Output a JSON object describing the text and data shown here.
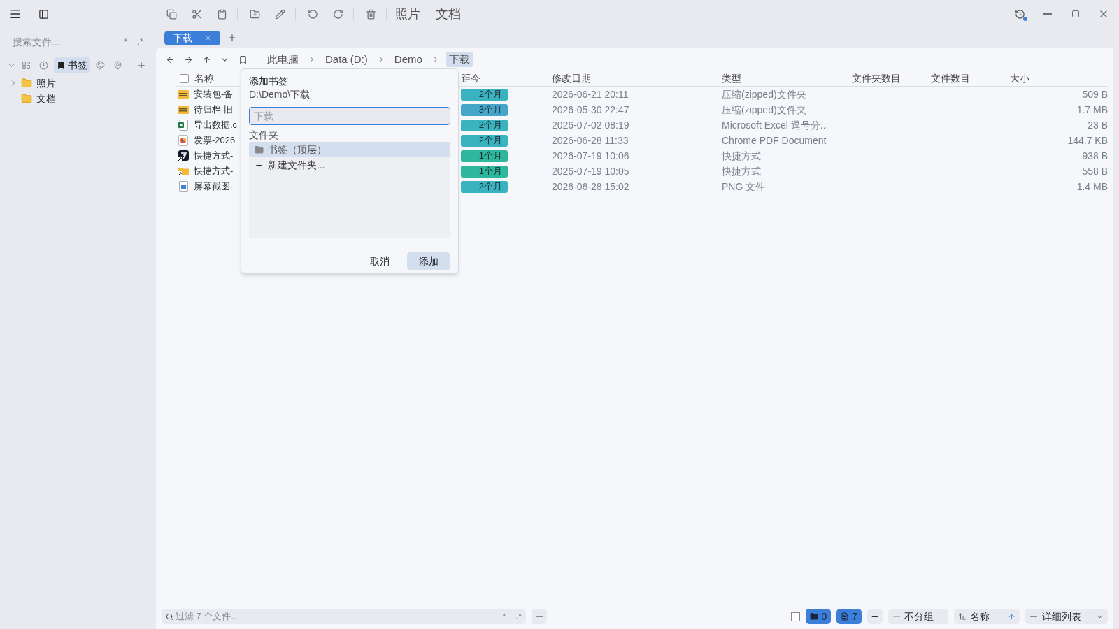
{
  "toolbar": {
    "quick_links": [
      {
        "label": "照片"
      },
      {
        "label": "文档"
      }
    ]
  },
  "sidebar": {
    "search": {
      "placeholder": "搜索文件...",
      "options": [
        "*",
        ".*"
      ]
    },
    "panel_tabs": [
      {
        "kind": "layout",
        "selected": false
      },
      {
        "kind": "recent",
        "selected": false
      },
      {
        "kind": "bookmarks",
        "label": "书签",
        "selected": true
      },
      {
        "kind": "tags",
        "selected": false
      },
      {
        "kind": "pins",
        "selected": false
      }
    ],
    "tree": [
      {
        "label": "照片",
        "expandable": true,
        "expanded": false
      },
      {
        "label": "文档",
        "expandable": false
      }
    ]
  },
  "tabs": [
    {
      "label": "下载",
      "selected": true
    }
  ],
  "breadcrumb": [
    {
      "label": "此电脑",
      "selected": false
    },
    {
      "label": "Data (D:)",
      "selected": false
    },
    {
      "label": "Demo",
      "selected": false
    },
    {
      "label": "下载",
      "selected": true
    }
  ],
  "table": {
    "select_all": {
      "checked": false
    },
    "columns": [
      "名称",
      "距今",
      "修改日期",
      "类型",
      "文件夹数目",
      "文件数目",
      "大小"
    ],
    "rows": [
      {
        "kind": "zip",
        "name": "安装包-备",
        "age": "2个月",
        "color": "#38b3bf",
        "modified": "2026-06-21 20:11",
        "type": "压缩(zipped)文件夹",
        "size": "509 B"
      },
      {
        "kind": "zip",
        "name": "待归档-旧",
        "age": "3个月",
        "color": "#45a6c9",
        "modified": "2026-05-30 22:47",
        "type": "压缩(zipped)文件夹",
        "size": "1.7 MB"
      },
      {
        "kind": "excel",
        "name": "导出数据.c",
        "age": "2个月",
        "color": "#38b3bf",
        "modified": "2026-07-02 08:19",
        "type": "Microsoft Excel 逗号分...",
        "size": "23 B"
      },
      {
        "kind": "pdf",
        "name": "发票-2026",
        "age": "2个月",
        "color": "#38b3bf",
        "modified": "2026-06-28 11:33",
        "type": "Chrome PDF Document",
        "size": "144.7 KB"
      },
      {
        "kind": "app-shortcut",
        "name": "快捷方式-",
        "age": "1个月",
        "color": "#2db89e",
        "modified": "2026-07-19 10:06",
        "type": "快捷方式",
        "size": "938 B"
      },
      {
        "kind": "folder-shortcut",
        "name": "快捷方式-",
        "age": "1个月",
        "color": "#2db89e",
        "modified": "2026-07-19 10:05",
        "type": "快捷方式",
        "size": "558 B"
      },
      {
        "kind": "image",
        "name": "屏幕截图-",
        "age": "2个月",
        "color": "#38b3bf",
        "modified": "2026-06-28 15:02",
        "type": "PNG 文件",
        "size": "1.4 MB"
      }
    ]
  },
  "dialog": {
    "title": "添加书签",
    "path": "D:\\Demo\\下载",
    "name_field": {
      "placeholder": "下载"
    },
    "folder_label": "文件夹",
    "folders": [
      {
        "kind": "folder",
        "label": "书签（顶层）",
        "selected": true
      },
      {
        "kind": "new",
        "label": "新建文件夹...",
        "selected": false
      }
    ],
    "buttons": [
      {
        "label": "取消",
        "primary": false
      },
      {
        "label": "添加",
        "primary": true
      }
    ]
  },
  "status_bar": {
    "select": {
      "checked": false
    },
    "filter": {
      "placeholder": "过滤 7 个文件..",
      "options": [
        "*",
        ".*"
      ]
    },
    "folder_count": "0",
    "file_count": "7",
    "grouping": "不分组",
    "sort": {
      "label": "名称",
      "ascending": true
    },
    "view": "详细列表"
  }
}
